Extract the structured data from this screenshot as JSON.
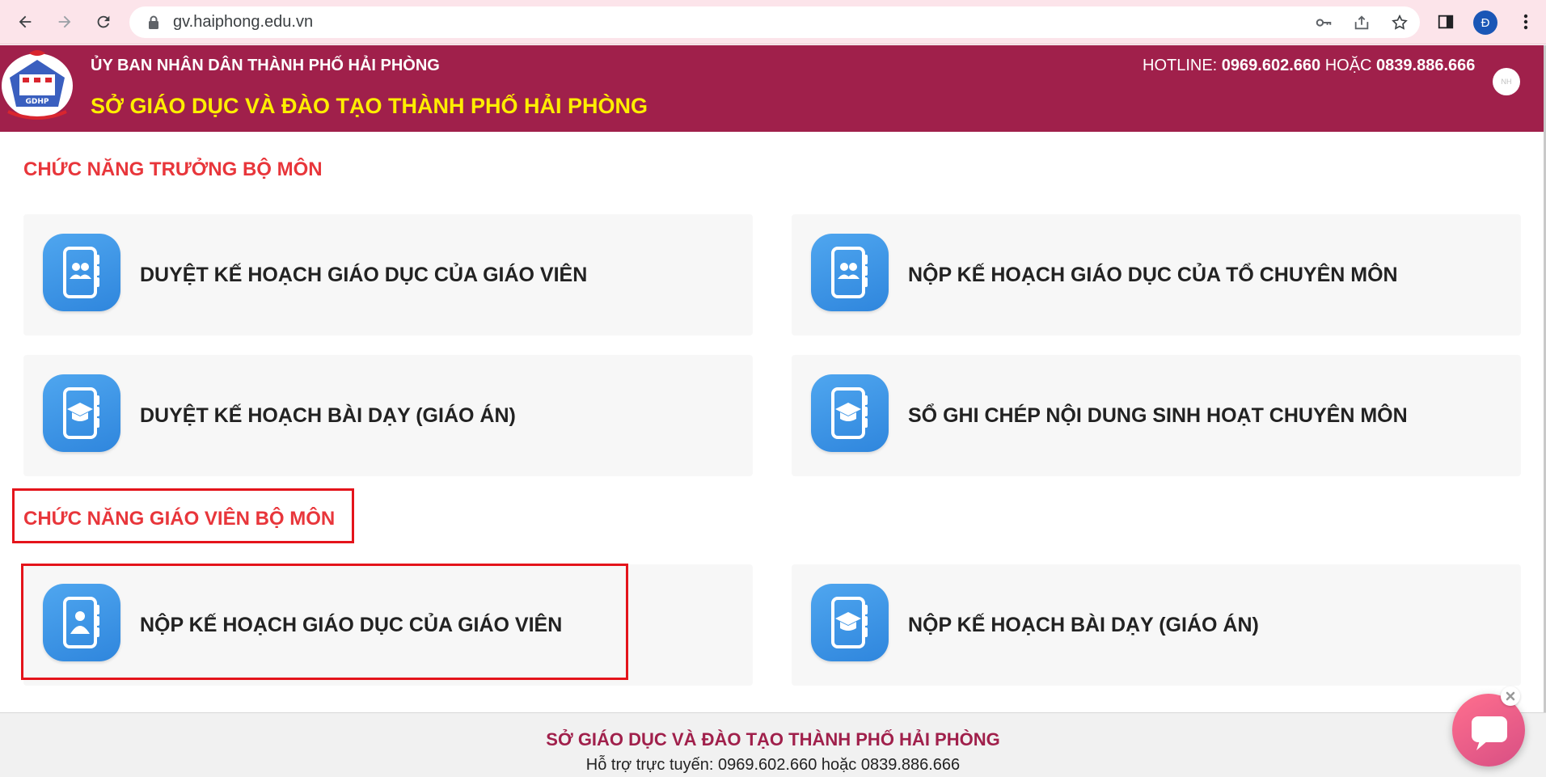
{
  "browser": {
    "url": "gv.haiphong.edu.vn",
    "profile_initial": "Đ",
    "icons": [
      "back-arrow-icon",
      "forward-arrow-icon",
      "reload-icon",
      "lock-icon",
      "key-icon",
      "share-icon",
      "star-icon",
      "side-panel-icon",
      "more-vert-icon"
    ]
  },
  "header": {
    "org_parent": "ỦY BAN NHÂN DÂN THÀNH PHỐ HẢI PHÒNG",
    "org_name": "SỞ GIÁO DỤC VÀ ĐÀO TẠO THÀNH PHỐ HẢI PHÒNG",
    "hotline_label": "HOTLINE: ",
    "hotline_1": "0969.602.660",
    "hotline_or": " HOẶC ",
    "hotline_2": "0839.886.666",
    "logo_text": "GDHP",
    "avatar_text": "NH"
  },
  "sections": [
    {
      "title": "CHỨC NĂNG TRƯỞNG BỘ MÔN",
      "cards": [
        {
          "label": "DUYỆT KẾ HOẠCH GIÁO DỤC CỦA GIÁO VIÊN",
          "icon": "group-book-icon"
        },
        {
          "label": "NỘP KẾ HOẠCH GIÁO DỤC CỦA TỔ CHUYÊN MÔN",
          "icon": "group-book-icon"
        },
        {
          "label": "DUYỆT KẾ HOẠCH BÀI DẠY (GIÁO ÁN)",
          "icon": "graduation-book-icon"
        },
        {
          "label": "SỔ GHI CHÉP NỘI DUNG SINH HOẠT CHUYÊN MÔN",
          "icon": "graduation-book-icon"
        }
      ]
    },
    {
      "title": "CHỨC NĂNG GIÁO VIÊN BỘ MÔN",
      "cards": [
        {
          "label": "NỘP KẾ HOẠCH GIÁO DỤC CỦA GIÁO VIÊN",
          "icon": "teacher-book-icon"
        },
        {
          "label": "NỘP KẾ HOẠCH BÀI DẠY (GIÁO ÁN)",
          "icon": "graduation-book-icon"
        }
      ]
    }
  ],
  "footer": {
    "title": "SỞ GIÁO DỤC VÀ ĐÀO TẠO THÀNH PHỐ HẢI PHÒNG",
    "support": "Hỗ trợ trực tuyến: 0969.602.660 hoặc 0839.886.666"
  },
  "colors": {
    "header_bg": "#a0204b",
    "org_name": "#ffee00",
    "section_title": "#e8363b",
    "highlight": "#e4141b",
    "icon_blue": "#3a92e6"
  }
}
